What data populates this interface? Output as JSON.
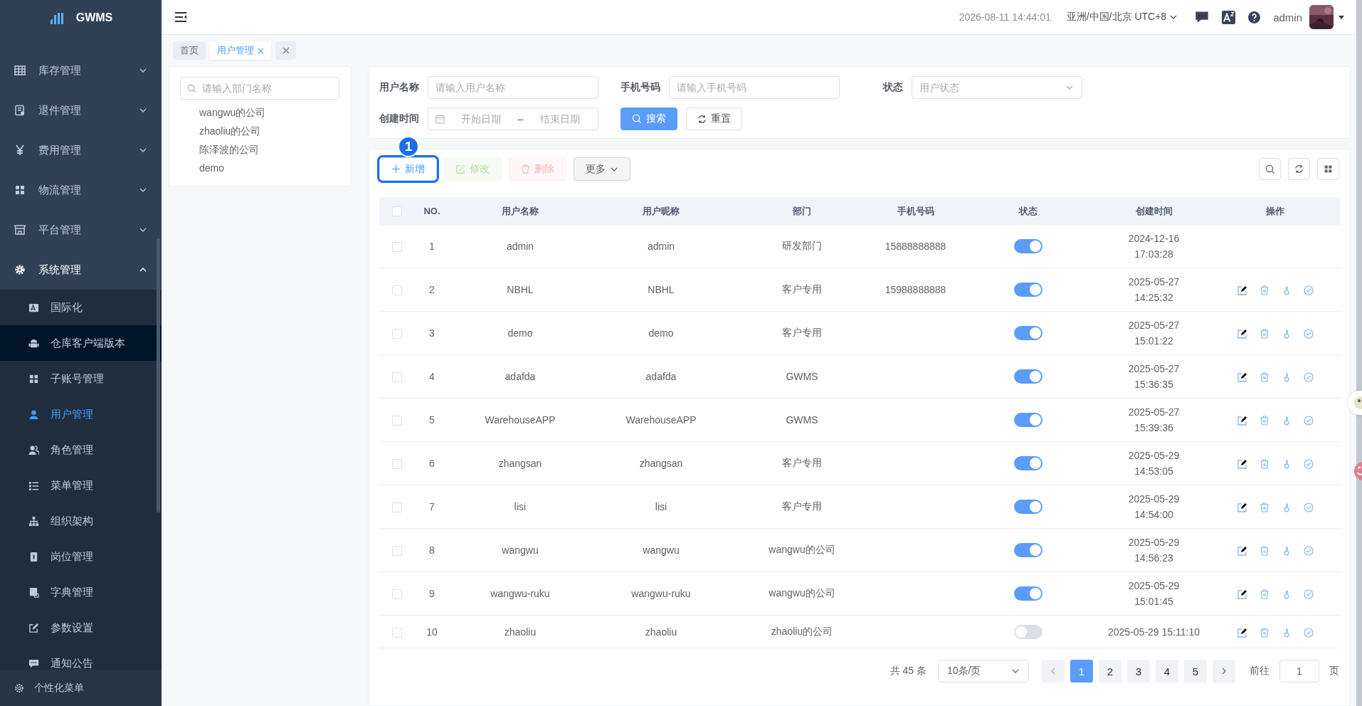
{
  "sidebar": {
    "logo": "GWMS",
    "items": [
      {
        "label": "库存管理",
        "expanded": false
      },
      {
        "label": "退件管理",
        "expanded": false
      },
      {
        "label": "费用管理",
        "expanded": false
      },
      {
        "label": "物流管理",
        "expanded": false
      },
      {
        "label": "平台管理",
        "expanded": false
      },
      {
        "label": "系统管理",
        "expanded": true,
        "children": [
          {
            "label": "国际化",
            "selected": false,
            "hovered": false
          },
          {
            "label": "仓库客户端版本",
            "selected": false,
            "hovered": true
          },
          {
            "label": "子账号管理",
            "selected": false,
            "hovered": false
          },
          {
            "label": "用户管理",
            "selected": true,
            "hovered": false
          },
          {
            "label": "角色管理",
            "selected": false,
            "hovered": false
          },
          {
            "label": "菜单管理",
            "selected": false,
            "hovered": false
          },
          {
            "label": "组织架构",
            "selected": false,
            "hovered": false
          },
          {
            "label": "岗位管理",
            "selected": false,
            "hovered": false
          },
          {
            "label": "字典管理",
            "selected": false,
            "hovered": false
          },
          {
            "label": "参数设置",
            "selected": false,
            "hovered": false
          },
          {
            "label": "通知公告",
            "selected": false,
            "hovered": false
          }
        ]
      }
    ],
    "footer": "个性化菜单"
  },
  "header": {
    "datetime": "2026-08-11 14:44:01",
    "timezone": "亚洲/中国/北京 UTC+8",
    "user": "admin"
  },
  "tabs": [
    {
      "label": "首页",
      "selected": false,
      "closable": false
    },
    {
      "label": "用户管理",
      "selected": true,
      "closable": true
    }
  ],
  "dept_panel": {
    "placeholder": "请输入部门名称",
    "items": [
      "wangwu的公司",
      "zhaoliu的公司",
      "陈泽波的公司",
      "demo"
    ]
  },
  "filters": [
    {
      "kind": "text",
      "label": "用户名称",
      "placeholder": "请输入用户名称"
    },
    {
      "kind": "text",
      "label": "手机号码",
      "placeholder": "请输入手机号码"
    },
    {
      "kind": "select",
      "label": "状态",
      "placeholder": "用户状态"
    },
    {
      "kind": "daterange",
      "label": "创建时间",
      "start_placeholder": "开始日期",
      "separator": "–",
      "end_placeholder": "结束日期"
    }
  ],
  "filter_buttons": [
    {
      "kind": "primary",
      "label": "搜索"
    },
    {
      "kind": "plain",
      "label": "重置"
    }
  ],
  "toolbar": {
    "step_marker": "1",
    "buttons": [
      {
        "kind": "primary",
        "label": "新增",
        "disabled": false,
        "highlighted": true
      },
      {
        "kind": "success",
        "label": "修改",
        "disabled": true,
        "highlighted": false
      },
      {
        "kind": "danger",
        "label": "删除",
        "disabled": true,
        "highlighted": false
      },
      {
        "kind": "more",
        "label": "更多",
        "disabled": false,
        "highlighted": false
      }
    ]
  },
  "table": {
    "select_all_checked": false,
    "columns": [
      "NO.",
      "用户名称",
      "用户昵称",
      "部门",
      "手机号码",
      "状态",
      "创建时间",
      "操作"
    ],
    "rows": [
      {
        "checked": false,
        "no": "1",
        "username": "admin",
        "nickname": "admin",
        "dept": "研发部门",
        "phone": "15888888888",
        "enabled": true,
        "created": "2024-12-16 17:03:28",
        "created_wrapped": true,
        "has_actions": false
      },
      {
        "checked": false,
        "no": "2",
        "username": "NBHL",
        "nickname": "NBHL",
        "dept": "客户专用",
        "phone": "15988888888",
        "enabled": true,
        "created": "2025-05-27 14:25:32",
        "created_wrapped": true,
        "has_actions": true
      },
      {
        "checked": false,
        "no": "3",
        "username": "demo",
        "nickname": "demo",
        "dept": "客户专用",
        "enabled": true,
        "created": "2025-05-27 15:01:22",
        "created_wrapped": true,
        "has_actions": true
      },
      {
        "checked": false,
        "no": "4",
        "username": "adafda",
        "nickname": "adafda",
        "dept": "GWMS",
        "enabled": true,
        "created": "2025-05-27 15:36:35",
        "created_wrapped": true,
        "has_actions": true
      },
      {
        "checked": false,
        "no": "5",
        "username": "WarehouseAPP",
        "nickname": "WarehouseAPP",
        "dept": "GWMS",
        "enabled": true,
        "created": "2025-05-27 15:39:36",
        "created_wrapped": true,
        "has_actions": true
      },
      {
        "checked": false,
        "no": "6",
        "username": "zhangsan",
        "nickname": "zhangsan",
        "dept": "客户专用",
        "enabled": true,
        "created": "2025-05-29 14:53:05",
        "created_wrapped": true,
        "has_actions": true
      },
      {
        "checked": false,
        "no": "7",
        "username": "lisi",
        "nickname": "lisi",
        "dept": "客户专用",
        "enabled": true,
        "created": "2025-05-29 14:54:00",
        "created_wrapped": true,
        "has_actions": true
      },
      {
        "checked": false,
        "no": "8",
        "username": "wangwu",
        "nickname": "wangwu",
        "dept": "wangwu的公司",
        "enabled": true,
        "created": "2025-05-29 14:56:23",
        "created_wrapped": true,
        "has_actions": true
      },
      {
        "checked": false,
        "no": "9",
        "username": "wangwu-ruku",
        "nickname": "wangwu-ruku",
        "dept": "wangwu的公司",
        "enabled": true,
        "created": "2025-05-29 15:01:45",
        "created_wrapped": true,
        "has_actions": true
      },
      {
        "checked": false,
        "no": "10",
        "username": "zhaoliu",
        "nickname": "zhaoliu",
        "dept": "zhaoliu的公司",
        "enabled": false,
        "created": "2025-05-29 15:11:10",
        "created_wrapped": false,
        "has_actions": true
      }
    ]
  },
  "pagination": {
    "total": "共 45 条",
    "page_size": "10条/页",
    "pages": [
      {
        "label": "1",
        "selected": true
      },
      {
        "label": "2",
        "selected": false
      },
      {
        "label": "3",
        "selected": false
      },
      {
        "label": "4",
        "selected": false
      },
      {
        "label": "5",
        "selected": false
      }
    ],
    "goto_label": "前往",
    "goto_value": "1",
    "goto_suffix": "页"
  }
}
